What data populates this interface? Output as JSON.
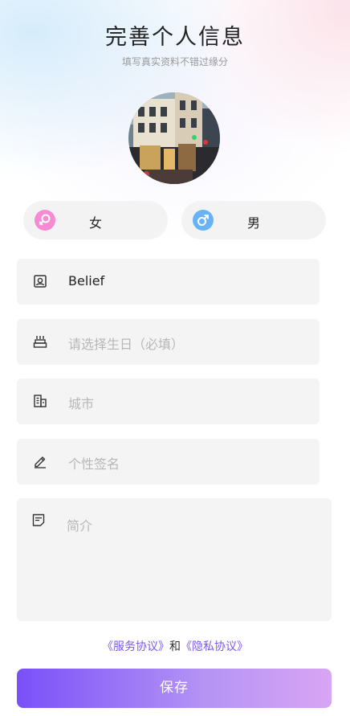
{
  "header": {
    "title": "完善个人信息",
    "subtitle": "填写真实资料不错过缘分"
  },
  "avatar": {
    "icon": "avatar-photo-street-scene"
  },
  "gender": {
    "female_label": "女",
    "male_label": "男",
    "female_color": "#f68bd4",
    "male_color": "#69b2f6"
  },
  "form": {
    "nickname_value": "Belief",
    "birthday_placeholder": "请选择生日（必填）",
    "city_placeholder": "城市",
    "signature_placeholder": "个性签名",
    "intro_placeholder": "简介"
  },
  "agreement": {
    "service_link": "《服务协议》",
    "joiner": "和",
    "privacy_link": "《隐私协议》"
  },
  "actions": {
    "save_label": "保存"
  },
  "colors": {
    "accent": "#7c58ee",
    "button_start": "#7a50f8",
    "button_end": "#d8a5f4"
  }
}
